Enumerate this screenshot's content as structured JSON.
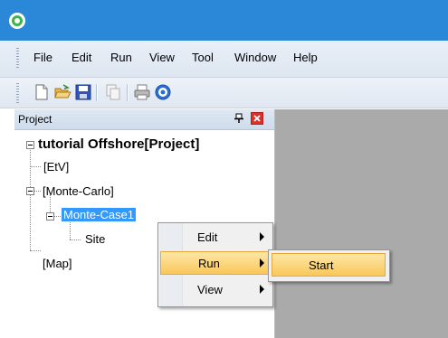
{
  "menubar": {
    "items": [
      "File",
      "Edit",
      "Run",
      "View",
      "Tool",
      "Window",
      "Help"
    ]
  },
  "toolbar": {
    "buttons": [
      "new-file-icon",
      "open-folder-icon",
      "save-icon",
      "copy-icon",
      "print-icon",
      "help-icon"
    ]
  },
  "project_panel": {
    "title": "Project",
    "pin_glyph": "📌",
    "close_glyph": "✕"
  },
  "tree": {
    "root": "tutorial Offshore[Project]",
    "etv": "[EtV]",
    "monte_carlo": "[Monte-Carlo]",
    "monte_case1": "Monte-Case1",
    "site": "Site",
    "map": "[Map]"
  },
  "context_menu": {
    "items": [
      "Edit",
      "Run",
      "View"
    ],
    "highlighted": "Run"
  },
  "submenu": {
    "items": [
      "Start"
    ]
  },
  "colors": {
    "titlebar": "#2b87d8",
    "selection": "#3399ff",
    "menu_highlight": "#f9c75b"
  }
}
